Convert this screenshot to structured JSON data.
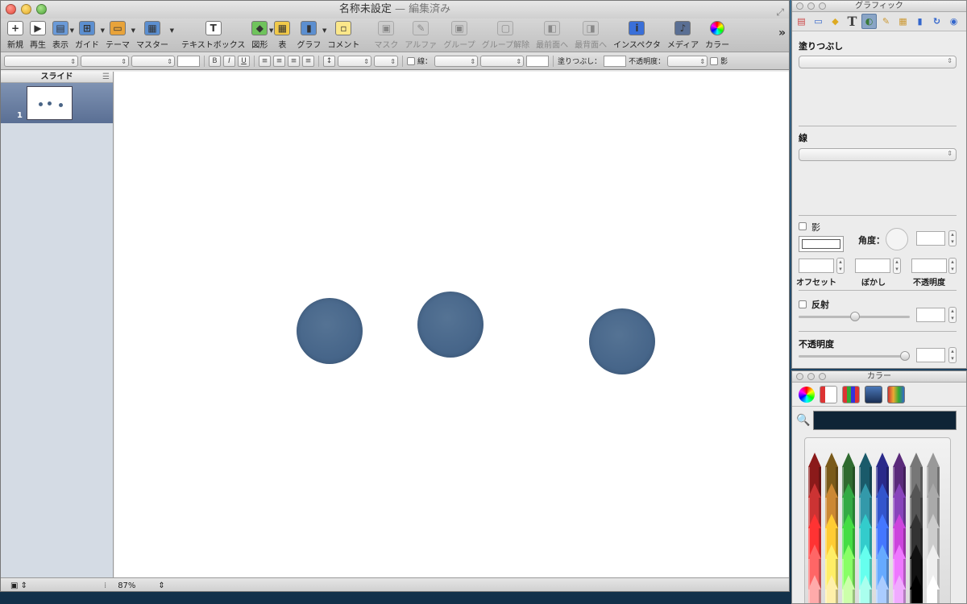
{
  "window": {
    "title": "名称未設定",
    "edited": "— 編集済み"
  },
  "toolbar": [
    {
      "label": "新規",
      "icon": "plus-icon",
      "sym": "+",
      "bg": "#ffffff",
      "disabled": false,
      "menu": false
    },
    {
      "label": "再生",
      "icon": "play-icon",
      "sym": "▶",
      "bg": "#ffffff",
      "disabled": false,
      "menu": false
    },
    {
      "label": "表示",
      "icon": "view-icon",
      "sym": "▤",
      "bg": "#6a9ad8",
      "disabled": false,
      "menu": true
    },
    {
      "label": "ガイド",
      "icon": "guide-icon",
      "sym": "⊞",
      "bg": "#5c8fd0",
      "disabled": false,
      "menu": true
    },
    {
      "label": "テーマ",
      "icon": "theme-icon",
      "sym": "▭",
      "bg": "#e8a33a",
      "disabled": false,
      "menu": true
    },
    {
      "label": "マスター",
      "icon": "master-icon",
      "sym": "▦",
      "bg": "#5c8fd0",
      "disabled": false,
      "menu": true
    },
    {
      "label": "テキストボックス",
      "icon": "textbox-icon",
      "sym": "T",
      "bg": "#ffffff",
      "disabled": false,
      "menu": false
    },
    {
      "label": "図形",
      "icon": "shapes-icon",
      "sym": "◆",
      "bg": "#6fc35c",
      "disabled": false,
      "menu": true
    },
    {
      "label": "表",
      "icon": "table-icon",
      "sym": "▦",
      "bg": "#f1c94a",
      "disabled": false,
      "menu": false
    },
    {
      "label": "グラフ",
      "icon": "chart-icon",
      "sym": "▮",
      "bg": "#5c8fd0",
      "disabled": false,
      "menu": true
    },
    {
      "label": "コメント",
      "icon": "comment-icon",
      "sym": "▫",
      "bg": "#fbe78a",
      "disabled": false,
      "menu": false
    },
    {
      "label": "マスク",
      "icon": "mask-icon",
      "sym": "▣",
      "bg": "#c8c8c8",
      "disabled": true,
      "menu": false
    },
    {
      "label": "アルファ",
      "icon": "alpha-icon",
      "sym": "✎",
      "bg": "#c8c8c8",
      "disabled": true,
      "menu": false
    },
    {
      "label": "グループ",
      "icon": "group-icon",
      "sym": "▣",
      "bg": "#c8c8c8",
      "disabled": true,
      "menu": false
    },
    {
      "label": "グループ解除",
      "icon": "ungroup-icon",
      "sym": "▢",
      "bg": "#c8c8c8",
      "disabled": true,
      "menu": false
    },
    {
      "label": "最前面へ",
      "icon": "front-icon",
      "sym": "◧",
      "bg": "#c8c8c8",
      "disabled": true,
      "menu": false
    },
    {
      "label": "最背面へ",
      "icon": "back-icon",
      "sym": "◨",
      "bg": "#c8c8c8",
      "disabled": true,
      "menu": false
    },
    {
      "label": "インスペクタ",
      "icon": "inspector-icon",
      "sym": "i",
      "bg": "#3a6fd8",
      "disabled": false,
      "menu": false
    },
    {
      "label": "メディア",
      "icon": "media-icon",
      "sym": "♪",
      "bg": "#5a6f94",
      "disabled": false,
      "menu": false
    },
    {
      "label": "カラー",
      "icon": "color-wheel-icon",
      "sym": "●",
      "bg": "#e85aa0",
      "disabled": false,
      "menu": false
    }
  ],
  "format": {
    "line_label": "線：",
    "fill_label": "塗りつぶし：",
    "opacity_label": "不透明度：",
    "shadow_label": "影"
  },
  "sidebar": {
    "title": "スライド",
    "slide_number": "1"
  },
  "bottom": {
    "zoom": "87%"
  },
  "inspector": {
    "title": "グラフィック",
    "fill_title": "塗りつぶし",
    "stroke_title": "線",
    "shadow_label": "影",
    "angle_label": "角度：",
    "offset_label": "オフセット",
    "blur_label": "ぼかし",
    "opacity_label": "不透明度",
    "reflection_label": "反射",
    "opacity_title": "不透明度"
  },
  "colors": {
    "title": "カラー",
    "current": "#0f2436"
  },
  "slide_circle_color": "#47668a"
}
